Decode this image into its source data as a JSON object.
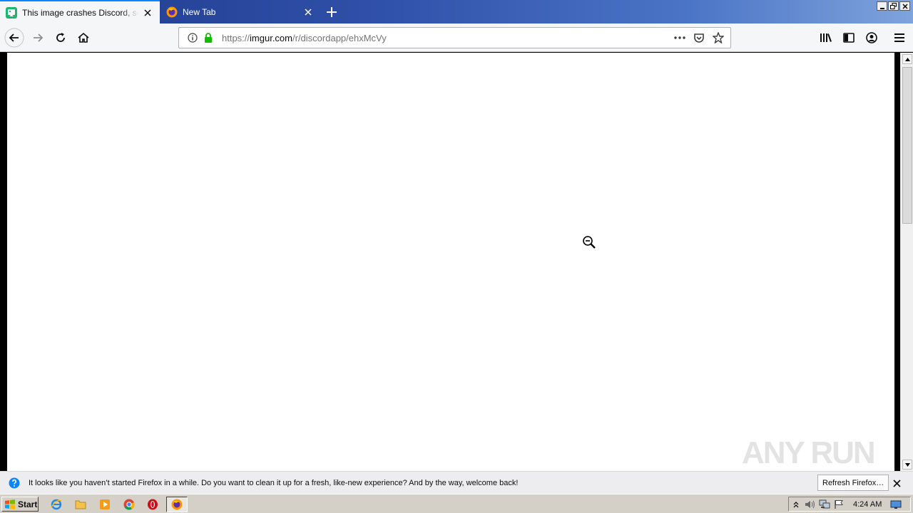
{
  "tabs": [
    {
      "title": "This image crashes Discord, send it",
      "active": true,
      "favicon": "imgur-favicon"
    },
    {
      "title": "New Tab",
      "active": false,
      "favicon": "firefox-favicon"
    }
  ],
  "toolbar": {
    "url_prefix": "https://",
    "url_host": "imgur.com",
    "url_path": "/r/discordapp/ehxMcVy"
  },
  "watermark": {
    "text": "ANY RUN"
  },
  "notification": {
    "message": "It looks like you haven’t started Firefox in a while. Do you want to clean it up for a fresh, like-new experience? And by the way, welcome back!",
    "button_label": "Refresh Firefox…"
  },
  "taskbar": {
    "start_label": "Start",
    "clock": "4:24 AM"
  },
  "colors": {
    "accent": "#0a84ff",
    "secure_lock": "#12bc00",
    "tabstrip": "#2f4fa8"
  }
}
